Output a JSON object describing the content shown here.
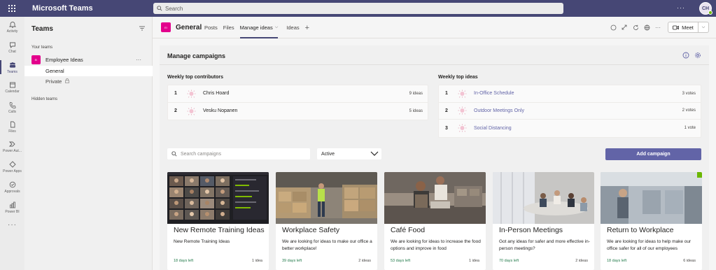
{
  "topbar": {
    "app_title": "Microsoft Teams",
    "search_placeholder": "Search",
    "more_label": "···",
    "avatar_initials": "CH",
    "bg_color": "#464775"
  },
  "rail": {
    "items": [
      {
        "label": "Activity",
        "icon": "bell-icon"
      },
      {
        "label": "Chat",
        "icon": "chat-icon"
      },
      {
        "label": "Teams",
        "icon": "teams-icon",
        "active": true
      },
      {
        "label": "Calendar",
        "icon": "calendar-icon"
      },
      {
        "label": "Calls",
        "icon": "phone-icon"
      },
      {
        "label": "Files",
        "icon": "file-icon"
      },
      {
        "label": "Power Aut...",
        "icon": "power-automate-icon"
      },
      {
        "label": "Power Apps",
        "icon": "power-apps-icon"
      },
      {
        "label": "Approvals",
        "icon": "approvals-icon"
      },
      {
        "label": "Power BI",
        "icon": "power-bi-icon"
      }
    ],
    "more_label": "···"
  },
  "teams_panel": {
    "title": "Teams",
    "your_teams_label": "Your teams",
    "team": {
      "badge": "EI",
      "name": "Employee Ideas",
      "more": "···"
    },
    "channels": [
      {
        "name": "General",
        "selected": true
      },
      {
        "name": "Private",
        "locked": true
      }
    ],
    "hidden_teams_label": "Hidden teams"
  },
  "channel_header": {
    "badge": "EI",
    "name": "General",
    "tabs": [
      {
        "label": "Posts"
      },
      {
        "label": "Files"
      },
      {
        "label": "Manage ideas",
        "active": true,
        "has_dropdown": true
      },
      {
        "label": "Ideas"
      }
    ],
    "add_tab_label": "+",
    "more_label": "···",
    "meet_label": "Meet"
  },
  "manage": {
    "title": "Manage campaigns",
    "contributors_title": "Weekly top contributors",
    "contributors": [
      {
        "rank": "1",
        "name": "Chris Hoard",
        "count": "9 ideas"
      },
      {
        "rank": "2",
        "name": "Vesku Nopanen",
        "count": "5 ideas"
      }
    ],
    "ideas_title": "Weekly top ideas",
    "top_ideas": [
      {
        "rank": "1",
        "name": "In-Office Schedule",
        "count": "3 votes"
      },
      {
        "rank": "2",
        "name": "Outdoor Meetings Only",
        "count": "2 votes"
      },
      {
        "rank": "3",
        "name": "Social Distancing",
        "count": "1 vote"
      }
    ],
    "search_placeholder": "Search campaigns",
    "status_value": "Active",
    "add_button_label": "Add campaign",
    "accent_color": "#6264a7"
  },
  "campaigns": [
    {
      "title": "New Remote Training Ideas",
      "description": "New Remote Training Ideas",
      "days_left": "18 days left",
      "count": "1 idea",
      "image": "video-call-grid"
    },
    {
      "title": "Workplace Safety",
      "description": "We are looking for ideas to make our office a better workplace!",
      "days_left": "39 days left",
      "count": "2 ideas",
      "image": "warehouse"
    },
    {
      "title": "Café Food",
      "description": "We are looking for ideas to increase the food options and improve in food",
      "days_left": "53 days left",
      "count": "1 idea",
      "image": "cafe"
    },
    {
      "title": "In-Person Meetings",
      "description": "Got any ideas for safer and more effective in-person meetings?",
      "days_left": "70 days left",
      "count": "2 ideas",
      "image": "meeting-room"
    },
    {
      "title": "Return to Workplace",
      "description": "We are looking for ideas to help make our office safer for all of our employees",
      "days_left": "18 days left",
      "count": "6 ideas",
      "image": "office"
    }
  ]
}
